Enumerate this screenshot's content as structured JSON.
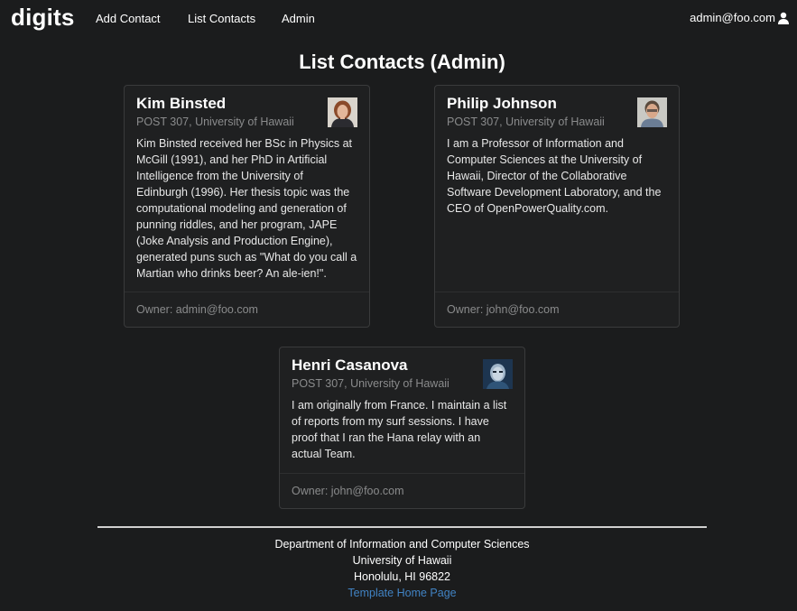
{
  "nav": {
    "brand": "digits",
    "items": [
      {
        "label": "Add Contact"
      },
      {
        "label": "List Contacts"
      },
      {
        "label": "Admin"
      }
    ],
    "user": "admin@foo.com",
    "user_icon": "user-icon"
  },
  "page": {
    "title": "List Contacts (Admin)"
  },
  "contacts": [
    {
      "name": "Kim Binsted",
      "address": "POST 307, University of Hawaii",
      "description": "Kim Binsted received her BSc in Physics at McGill (1991), and her PhD in Artificial Intelligence from the University of Edinburgh (1996). Her thesis topic was the computational modeling and generation of punning riddles, and her program, JAPE (Joke Analysis and Production Engine), generated puns such as \"What do you call a Martian who drinks beer? An ale-ien!\".",
      "owner": "Owner: admin@foo.com"
    },
    {
      "name": "Philip Johnson",
      "address": "POST 307, University of Hawaii",
      "description": "I am a Professor of Information and Computer Sciences at the University of Hawaii, Director of the Collaborative Software Development Laboratory, and the CEO of OpenPowerQuality.com.",
      "owner": "Owner: john@foo.com"
    },
    {
      "name": "Henri Casanova",
      "address": "POST 307, University of Hawaii",
      "description": "I am originally from France. I maintain a list of reports from my surf sessions. I have proof that I ran the Hana relay with an actual Team.",
      "owner": "Owner: john@foo.com"
    }
  ],
  "footer": {
    "line1": "Department of Information and Computer Sciences",
    "line2": "University of Hawaii",
    "line3": "Honolulu, HI 96822",
    "link": "Template Home Page"
  },
  "colors": {
    "background": "#1b1c1d",
    "card_border": "#3a3b3c",
    "link": "#4183c4"
  }
}
